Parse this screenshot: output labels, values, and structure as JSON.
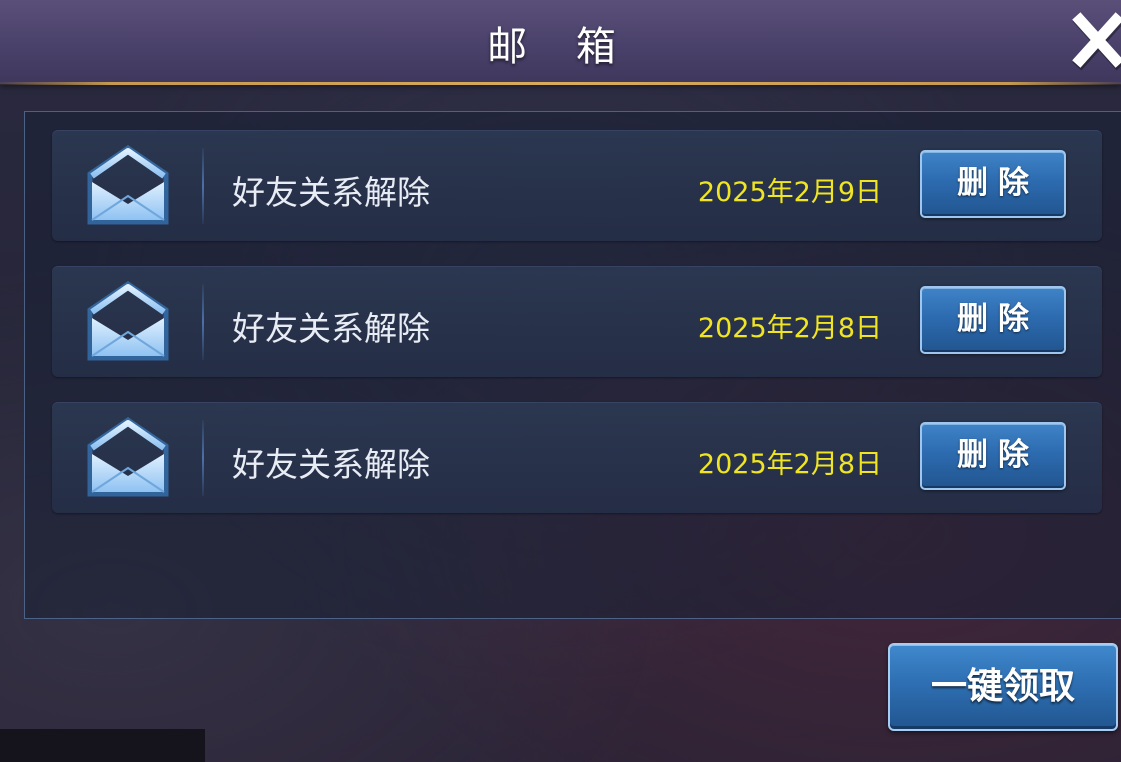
{
  "header": {
    "title": "邮 箱",
    "close_icon": "close-icon"
  },
  "mails": [
    {
      "icon": "envelope-icon",
      "subject": "好友关系解除",
      "date": "2025年2月9日",
      "delete_label": "删除"
    },
    {
      "icon": "envelope-icon",
      "subject": "好友关系解除",
      "date": "2025年2月8日",
      "delete_label": "删除"
    },
    {
      "icon": "envelope-icon",
      "subject": "好友关系解除",
      "date": "2025年2月8日",
      "delete_label": "删除"
    }
  ],
  "footer": {
    "claim_all_label": "一键领取"
  },
  "colors": {
    "header_bg": "#4a416a",
    "header_accent": "#c59a50",
    "date_text": "#f0e522",
    "button_blue": "#2d6bb0",
    "button_border": "#9fc6ee"
  }
}
